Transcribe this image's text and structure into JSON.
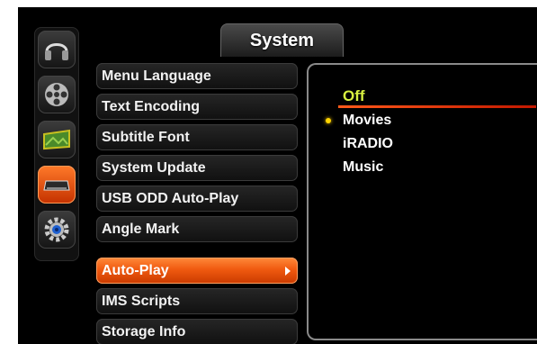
{
  "header": {
    "title": "System"
  },
  "sidebar": {
    "icons": [
      {
        "name": "headphones-icon",
        "active": false
      },
      {
        "name": "film-reel-icon",
        "active": false
      },
      {
        "name": "photo-icon",
        "active": false
      },
      {
        "name": "system-device-icon",
        "active": true
      },
      {
        "name": "settings-gear-icon",
        "active": false
      }
    ]
  },
  "menu": {
    "items": [
      {
        "label": "Menu Language"
      },
      {
        "label": "Text Encoding"
      },
      {
        "label": "Subtitle Font"
      },
      {
        "label": "System Update"
      },
      {
        "label": "USB ODD Auto-Play"
      },
      {
        "label": "Angle Mark"
      },
      {
        "label": "Auto-Play",
        "selected": true
      },
      {
        "label": "IMS Scripts"
      },
      {
        "label": "Storage Info"
      }
    ]
  },
  "options": {
    "items": [
      {
        "label": "Off",
        "highlighted": true
      },
      {
        "label": "Movies",
        "current": true
      },
      {
        "label": "iRADIO"
      },
      {
        "label": "Music"
      }
    ]
  },
  "colors": {
    "accent": "#f05a10",
    "highlight_text": "#d8f040",
    "current_dot": "#ffd400"
  }
}
